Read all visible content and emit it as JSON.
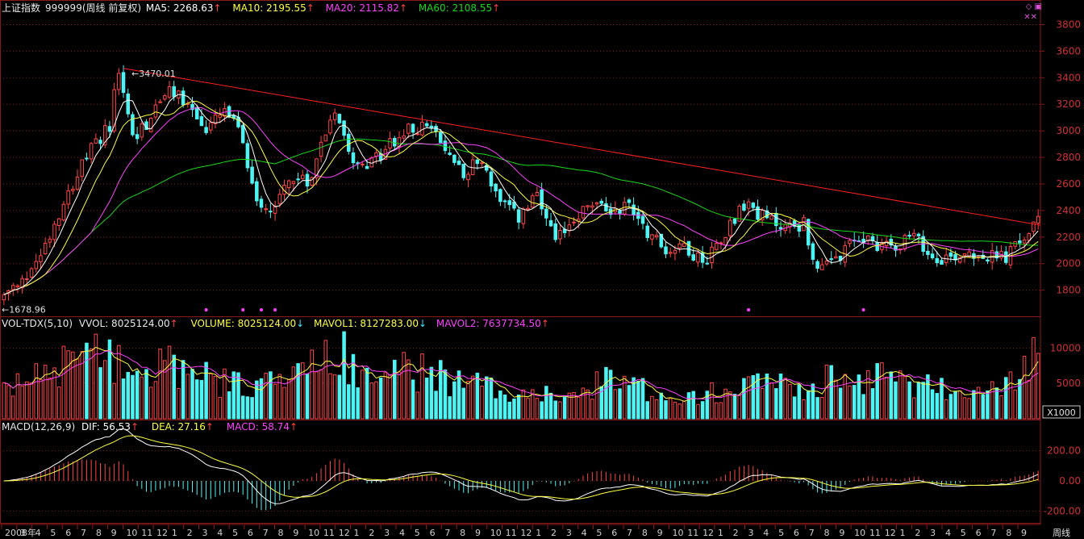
{
  "colors": {
    "up": "#ff4545",
    "down": "#4ef4f4",
    "ma5": "#ffffff",
    "ma10": "#ffff40",
    "ma20": "#ff40ff",
    "ma60": "#18d818",
    "grid": "#8a1a1a",
    "axis": "#c8c8c8",
    "trend": "#ff2020"
  },
  "header": {
    "price": {
      "name": "上证指数",
      "code": "999999(周线 前复权)",
      "ma5": "MA5: 2268.63",
      "ma5_arrow": "↑",
      "ma10": "MA10: 2195.55",
      "ma10_arrow": "↑",
      "ma20": "MA20: 2115.82",
      "ma20_arrow": "↑",
      "ma60": "MA60: 2108.55",
      "ma60_arrow": "↑"
    },
    "volume": {
      "name": "VOL-TDX(5,10)",
      "vvol": "VVOL: 8025124.00",
      "vvol_arrow": "↑",
      "volume": "VOLUME: 8025124.00",
      "volume_arrow": "↓",
      "mavol1": "MAVOL1: 8127283.00",
      "mavol1_arrow": "↓",
      "mavol2": "MAVOL2: 7637734.50",
      "mavol2_arrow": "↑"
    },
    "macd": {
      "name": "MACD(12,26,9)",
      "dif": "DIF: 56.53",
      "dif_arrow": "↑",
      "dea": "DEA: 27.16",
      "dea_arrow": "↑",
      "macd": "MACD: 58.74",
      "macd_arrow": "↑"
    }
  },
  "corner_icons": "◇ ▣",
  "corner_marks": "✕✕",
  "chart_data": [
    {
      "type": "candlestick",
      "series_labels": [
        "MA5",
        "MA10",
        "MA20",
        "MA60"
      ],
      "y_ticks": [
        1800,
        2000,
        2200,
        2400,
        2600,
        2800,
        3000,
        3200,
        3400,
        3600,
        3800
      ],
      "ylim": [
        1640,
        3900
      ],
      "annotations": {
        "high_label": "3470.01",
        "low_label": "1678.96",
        "high": 3470.01,
        "low": 1678.96
      },
      "anchors": [
        [
          0,
          1750
        ],
        [
          4,
          1850
        ],
        [
          9,
          2150
        ],
        [
          14,
          2550
        ],
        [
          18,
          2800
        ],
        [
          23,
          3050
        ],
        [
          25,
          3460
        ],
        [
          28,
          2950
        ],
        [
          31,
          3050
        ],
        [
          35,
          3280
        ],
        [
          38,
          3280
        ],
        [
          41,
          3150
        ],
        [
          44,
          3000
        ],
        [
          48,
          3150
        ],
        [
          51,
          3000
        ],
        [
          55,
          2500
        ],
        [
          58,
          2400
        ],
        [
          62,
          2650
        ],
        [
          66,
          2600
        ],
        [
          70,
          3000
        ],
        [
          72,
          3180
        ],
        [
          76,
          2800
        ],
        [
          80,
          2750
        ],
        [
          84,
          2900
        ],
        [
          88,
          3000
        ],
        [
          92,
          3050
        ],
        [
          96,
          2850
        ],
        [
          100,
          2700
        ],
        [
          104,
          2780
        ],
        [
          108,
          2450
        ],
        [
          112,
          2350
        ],
        [
          116,
          2500
        ],
        [
          120,
          2150
        ],
        [
          124,
          2350
        ],
        [
          128,
          2450
        ],
        [
          132,
          2400
        ],
        [
          136,
          2450
        ],
        [
          140,
          2250
        ],
        [
          144,
          2100
        ],
        [
          148,
          2150
        ],
        [
          152,
          2000
        ],
        [
          156,
          2200
        ],
        [
          160,
          2400
        ],
        [
          162,
          2450
        ],
        [
          165,
          2350
        ],
        [
          170,
          2280
        ],
        [
          174,
          2300
        ],
        [
          176,
          2050
        ],
        [
          178,
          1950
        ],
        [
          182,
          2050
        ],
        [
          186,
          2200
        ],
        [
          190,
          2150
        ],
        [
          194,
          2150
        ],
        [
          198,
          2200
        ],
        [
          202,
          2050
        ],
        [
          206,
          2050
        ],
        [
          210,
          2100
        ],
        [
          214,
          2050
        ],
        [
          218,
          2050
        ],
        [
          222,
          2200
        ],
        [
          225,
          2310
        ]
      ],
      "volume_anchors": [
        [
          0,
          3500
        ],
        [
          6,
          6000
        ],
        [
          12,
          8000
        ],
        [
          18,
          8500
        ],
        [
          25,
          9000
        ],
        [
          30,
          6000
        ],
        [
          36,
          8000
        ],
        [
          42,
          6000
        ],
        [
          48,
          5000
        ],
        [
          55,
          5000
        ],
        [
          62,
          5500
        ],
        [
          68,
          7000
        ],
        [
          72,
          10000
        ],
        [
          76,
          8000
        ],
        [
          82,
          6000
        ],
        [
          88,
          7000
        ],
        [
          94,
          6000
        ],
        [
          100,
          5000
        ],
        [
          110,
          4000
        ],
        [
          120,
          3000
        ],
        [
          126,
          4000
        ],
        [
          132,
          5500
        ],
        [
          140,
          4000
        ],
        [
          148,
          3000
        ],
        [
          156,
          4000
        ],
        [
          162,
          6500
        ],
        [
          168,
          5000
        ],
        [
          174,
          4000
        ],
        [
          180,
          5500
        ],
        [
          186,
          5000
        ],
        [
          190,
          7000
        ],
        [
          196,
          4500
        ],
        [
          202,
          5000
        ],
        [
          208,
          3000
        ],
        [
          214,
          3500
        ],
        [
          220,
          5500
        ],
        [
          224,
          8500
        ],
        [
          225,
          8000
        ]
      ],
      "vol_ticks": [
        5000,
        10000
      ],
      "vol_unit": "X1000",
      "macd_ticks": [
        "200.00",
        "0.00",
        "-200.00"
      ],
      "x_labels": [
        "2008年",
        "3",
        "4",
        "5",
        "6",
        "7",
        "8",
        "9",
        "10",
        "11",
        "12",
        "1",
        "2",
        "3",
        "4",
        "5",
        "6",
        "7",
        "8",
        "9",
        "10",
        "11",
        "12",
        "1",
        "2",
        "3",
        "4",
        "5",
        "6",
        "7",
        "8",
        "9",
        "10",
        "11",
        "12",
        "1",
        "2",
        "3",
        "4",
        "5",
        "6",
        "7",
        "8",
        "9",
        "10",
        "11",
        "12",
        "1",
        "2",
        "3",
        "4",
        "5",
        "6",
        "7",
        "8",
        "9",
        "10",
        "11",
        "12",
        "1",
        "2",
        "3",
        "4",
        "5",
        "6",
        "7",
        "8",
        "9"
      ],
      "x_unit": "周线"
    }
  ]
}
